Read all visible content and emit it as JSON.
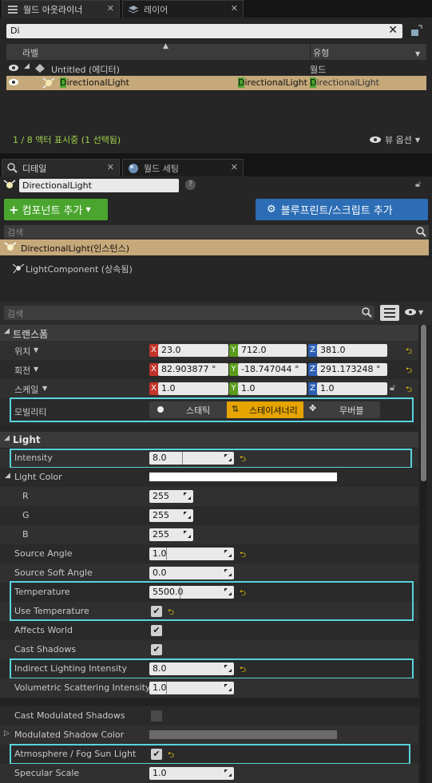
{
  "outliner": {
    "tabs": [
      {
        "label": "월드 아웃라이너"
      },
      {
        "label": "레이어"
      }
    ],
    "search_value": "Di",
    "columns": {
      "label": "라벨",
      "type": "유형"
    },
    "rows": [
      {
        "name": "Untitled (에디터)",
        "type": "월드"
      },
      {
        "name_hl": "D",
        "name_rest": "irectionalLight",
        "col2_hl": "D",
        "col2_rest": "irectionalLight",
        "type_hl": "D",
        "type_rest": "irectionalLight"
      }
    ],
    "status": "1 / 8 액터 표시중 (1 선택됨)",
    "view_options": "뷰 옵션"
  },
  "details": {
    "tabs": [
      {
        "label": "디테일"
      },
      {
        "label": "월드 세팅"
      }
    ],
    "actor_name": "DirectionalLight",
    "add_component": "컴포넌트 추가",
    "blueprint_button": "블루프린트/스크립트 추가",
    "component_search_placeholder": "검색",
    "components": [
      {
        "label": "DirectionalLight(인스턴스)"
      },
      {
        "label": "LightComponent (상속됨)"
      }
    ],
    "prop_search_placeholder": "검색",
    "transform": {
      "header": "트랜스폼",
      "location": {
        "label": "위치",
        "x": "23.0",
        "y": "712.0",
        "z": "381.0"
      },
      "rotation": {
        "label": "회전",
        "x": "82.903877 °",
        "y": "-18.747044 °",
        "z": "291.173248 °"
      },
      "scale": {
        "label": "스케일",
        "x": "1.0",
        "y": "1.0",
        "z": "1.0"
      },
      "mobility": {
        "label": "모빌리티",
        "options": [
          "스태틱",
          "스테이셔너리",
          "무버블"
        ],
        "selected": "스테이셔너리"
      }
    },
    "light": {
      "header": "Light",
      "intensity": {
        "label": "Intensity",
        "value": "8.0"
      },
      "light_color": {
        "label": "Light Color",
        "color": "#ffffff"
      },
      "r": {
        "label": "R",
        "value": "255"
      },
      "g": {
        "label": "G",
        "value": "255"
      },
      "b": {
        "label": "B",
        "value": "255"
      },
      "source_angle": {
        "label": "Source Angle",
        "value": "1.0"
      },
      "source_soft_angle": {
        "label": "Source Soft Angle",
        "value": "0.0"
      },
      "temperature": {
        "label": "Temperature",
        "value": "5500.0"
      },
      "use_temperature": {
        "label": "Use Temperature"
      },
      "affects_world": {
        "label": "Affects World"
      },
      "cast_shadows": {
        "label": "Cast Shadows"
      },
      "indirect": {
        "label": "Indirect Lighting Intensity",
        "value": "8.0"
      },
      "volumetric": {
        "label": "Volumetric Scattering Intensity",
        "value": "1.0"
      },
      "cast_modulated": {
        "label": "Cast Modulated Shadows"
      },
      "modulated_color": {
        "label": "Modulated Shadow Color",
        "color": "#6a6a6a"
      },
      "atmosphere": {
        "label": "Atmosphere / Fog Sun Light"
      },
      "specular": {
        "label": "Specular Scale",
        "value": "1.0"
      }
    }
  },
  "colors": {
    "highlight": "#58d3dd",
    "accent_green": "#4aa52e",
    "accent_blue": "#2c6db5",
    "selection": "#c6a97a",
    "reset": "#f5d400"
  }
}
